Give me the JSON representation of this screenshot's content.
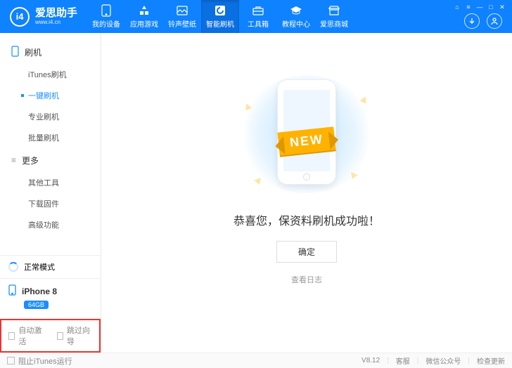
{
  "brand": {
    "name": "爱思助手",
    "url": "www.i4.cn",
    "logo_text": "i4"
  },
  "nav": [
    {
      "label": "我的设备"
    },
    {
      "label": "应用游戏"
    },
    {
      "label": "铃声壁纸"
    },
    {
      "label": "智能刷机"
    },
    {
      "label": "工具箱"
    },
    {
      "label": "教程中心"
    },
    {
      "label": "爱思商城"
    }
  ],
  "sidebar": {
    "section1_title": "刷机",
    "items1": [
      "iTunes刷机",
      "一键刷机",
      "专业刷机",
      "批量刷机"
    ],
    "section2_title": "更多",
    "items2": [
      "其他工具",
      "下载固件",
      "高级功能"
    ],
    "status": "正常模式",
    "device_name": "iPhone 8",
    "device_badge": "64GB",
    "opt_auto_activate": "自动激活",
    "opt_skip_wizard": "跳过向导"
  },
  "main": {
    "ribbon": "NEW",
    "success": "恭喜您，保资料刷机成功啦！",
    "ok": "确定",
    "log": "查看日志"
  },
  "footer": {
    "block_itunes": "阻止iTunes运行",
    "version": "V8.12",
    "support": "客服",
    "wechat": "微信公众号",
    "update": "检查更新"
  }
}
